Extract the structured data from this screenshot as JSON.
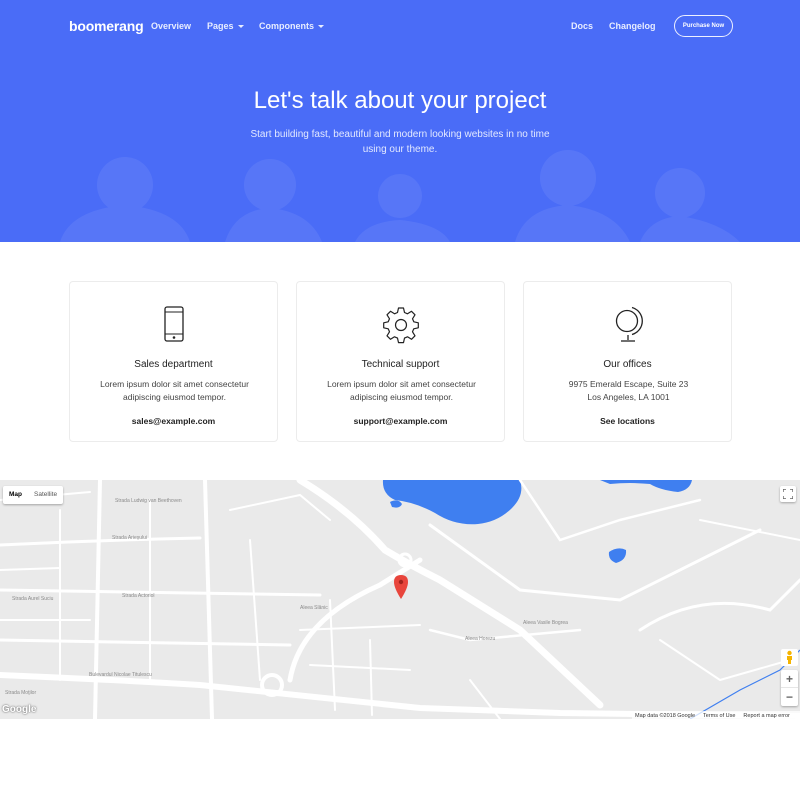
{
  "nav": {
    "brand": "boomerang",
    "links": [
      "Overview",
      "Pages",
      "Components"
    ],
    "right_links": [
      "Docs",
      "Changelog"
    ],
    "purchase": "Purchase Now"
  },
  "hero": {
    "title": "Let's talk about your project",
    "subtitle": "Start building fast, beautiful and modern looking websites in no time using our theme."
  },
  "cards": [
    {
      "icon": "phone-icon",
      "title": "Sales department",
      "text": "Lorem ipsum dolor sit amet consectetur adipiscing eiusmod tempor.",
      "link": "sales@example.com"
    },
    {
      "icon": "gear-icon",
      "title": "Technical support",
      "text": "Lorem ipsum dolor sit amet consectetur adipiscing eiusmod tempor.",
      "link": "support@example.com"
    },
    {
      "icon": "globe-icon",
      "title": "Our offices",
      "text_line1": "9975 Emerald Escape, Suite 23",
      "text_line2": "Los Angeles, LA 1001",
      "link": "See locations"
    }
  ],
  "map": {
    "type_map": "Map",
    "type_satellite": "Satellite",
    "logo": "Google",
    "footer": [
      "Map data ©2018 Google",
      "Terms of Use",
      "Report a map error"
    ],
    "streets": [
      "Strada Ludwig van Beethoven",
      "Strada Arieșului",
      "Strada Aurel Suciu",
      "Strada Actoriol",
      "Aleea Slănic",
      "Aleea Horezu",
      "Bulevardul Nicolae Titulescu",
      "Aleea Vasile Bogrea",
      "Strada Moţilor"
    ]
  },
  "colors": {
    "accent": "#4a6cf7",
    "water": "#3f7ff0",
    "pin": "#e8453c"
  }
}
